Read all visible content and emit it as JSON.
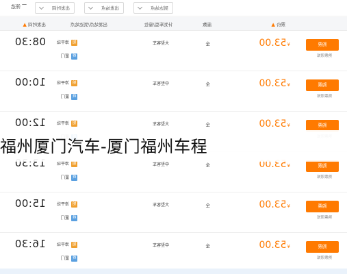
{
  "filter_bar": {
    "items": [
      "出发时间",
      "出发站点",
      "到达站点",
      "车型"
    ],
    "filter_label": "筛选"
  },
  "header": {
    "departure": "出发时间",
    "stations": "出发站点/到达站点",
    "bus_model": "计划车型/座位",
    "seats": "座数",
    "price": "票价"
  },
  "rows": [
    {
      "time": "08:30",
      "from": "漳平站",
      "to": "厦门",
      "model": "大型客车",
      "seats": "全",
      "currency": "¥",
      "price": "53.00",
      "button": "购票",
      "remark": "购票须知"
    },
    {
      "time": "10:00",
      "from": "漳平站",
      "to": "厦门",
      "model": "中型客车",
      "seats": "全",
      "currency": "¥",
      "price": "53.00",
      "button": "购票",
      "remark": "购票须知"
    },
    {
      "time": "12:00",
      "from": "漳平站",
      "to": "厦门",
      "model": "大型客车",
      "seats": "全",
      "currency": "¥",
      "price": "53.00",
      "button": "购票",
      "remark": "购票须知"
    },
    {
      "time": "13:30",
      "from": "漳平站",
      "to": "厦门",
      "model": "中型客车",
      "seats": "全",
      "currency": "¥",
      "price": "53.00",
      "button": "购票",
      "remark": "购票须知"
    },
    {
      "time": "15:00",
      "from": "漳平站",
      "to": "厦门",
      "model": "大型客车",
      "seats": "全",
      "currency": "¥",
      "price": "53.00",
      "button": "购票",
      "remark": "购票须知"
    },
    {
      "time": "16:30",
      "from": "漳平站",
      "to": "厦门",
      "model": "中型客车",
      "seats": "全",
      "currency": "¥",
      "price": "53.00",
      "button": "购票",
      "remark": "购票须知"
    }
  ],
  "caption": "福州厦门汽车-厦门福州车程",
  "colors": {
    "accent": "#ff7a00",
    "start_tag": "#f0a030",
    "end_tag": "#5aa0e0"
  }
}
